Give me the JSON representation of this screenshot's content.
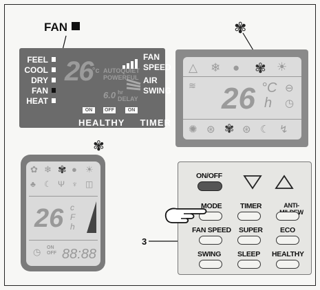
{
  "caption": {
    "fan_label": "FAN"
  },
  "panel1": {
    "mode_labels": [
      "FEEL",
      "COOL",
      "DRY",
      "FAN",
      "HEAT"
    ],
    "temp": "26",
    "temp_unit": "°c",
    "auto_quiet": "AUTOQUIET",
    "powerful": "POWERFUL",
    "right_labels": [
      "FAN",
      "SPEED",
      "AIR",
      "SWING"
    ],
    "delay_value": "6.0",
    "hr": "hr",
    "delay": "DELAY",
    "on_box": "ON",
    "off_box": "OFF",
    "on_box2": "ON",
    "bottom_healthy": "HEALTHY",
    "bottom_timer": "TIMER"
  },
  "panel2": {
    "temp": "26",
    "unit_c": "°C",
    "unit_h": "h",
    "icon_top": "fan-icon"
  },
  "panel3": {
    "temp": "26",
    "unit_c": "c",
    "unit_f": "F",
    "unit_h": "h",
    "on": "ON",
    "off": "OFF",
    "digits": "88:88"
  },
  "remote": {
    "onoff": "ON/OFF",
    "mode": "MODE",
    "timer": "TIMER",
    "anti_mildew": "ANTI-MILDEW",
    "fan_speed": "FAN SPEED",
    "super": "SUPER",
    "eco": "ECO",
    "swing": "SWING",
    "sleep": "SLEEP",
    "healthy": "HEALTHY"
  },
  "callout_number": "3"
}
